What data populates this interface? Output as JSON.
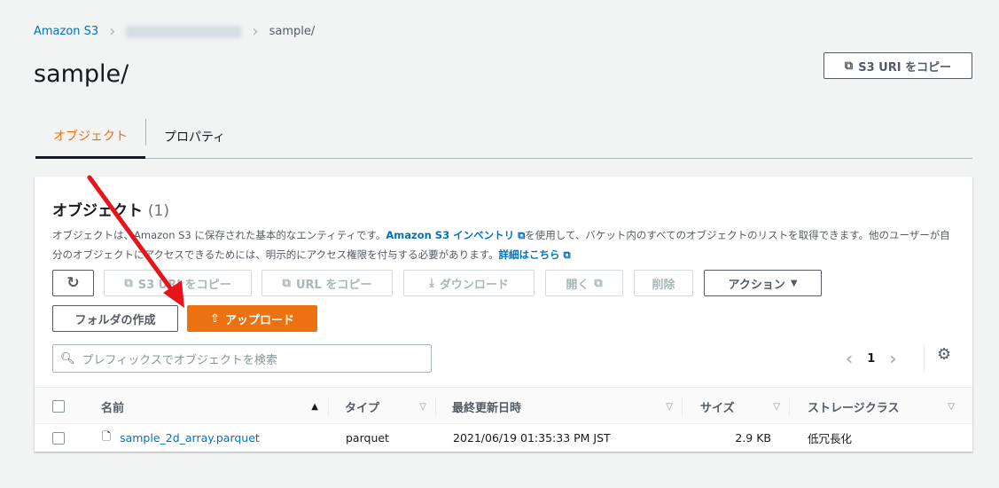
{
  "breadcrumb": {
    "root": "Amazon S3",
    "current": "sample/"
  },
  "page_title": "sample/",
  "copy_uri_button": "S3 URI をコピー",
  "tabs": [
    "オブジェクト",
    "プロパティ"
  ],
  "panel": {
    "title": "オブジェクト",
    "count": "(1)",
    "desc_1": "オブジェクトは、Amazon S3 に保存された基本的なエンティティです。",
    "desc_link_1": "Amazon S3 インベントリ",
    "desc_2": "を使用して、バケット内のすべてのオブジェクトのリストを取得できます。他のユーザーが自分のオブジェクトにアクセスできるためには、明示的にアクセス権限を付与する必要があります。",
    "desc_link_2": "詳細はこちら"
  },
  "toolbar": {
    "copy_s3_uri": "S3 URI をコピー",
    "copy_url": "URL をコピー",
    "download": "ダウンロード",
    "open": "開く",
    "delete": "削除",
    "actions": "アクション",
    "create_folder": "フォルダの作成",
    "upload": "アップロード"
  },
  "search": {
    "placeholder": "プレフィックスでオブジェクトを検索"
  },
  "pagination": {
    "page": "1"
  },
  "table": {
    "columns": [
      "名前",
      "タイプ",
      "最終更新日時",
      "サイズ",
      "ストレージクラス"
    ],
    "rows": [
      {
        "name": "sample_2d_array.parquet",
        "type": "parquet",
        "modified": "2021/06/19 01:35:33 PM JST",
        "size": "2.9 KB",
        "storage_class": "低冗長化"
      }
    ]
  }
}
